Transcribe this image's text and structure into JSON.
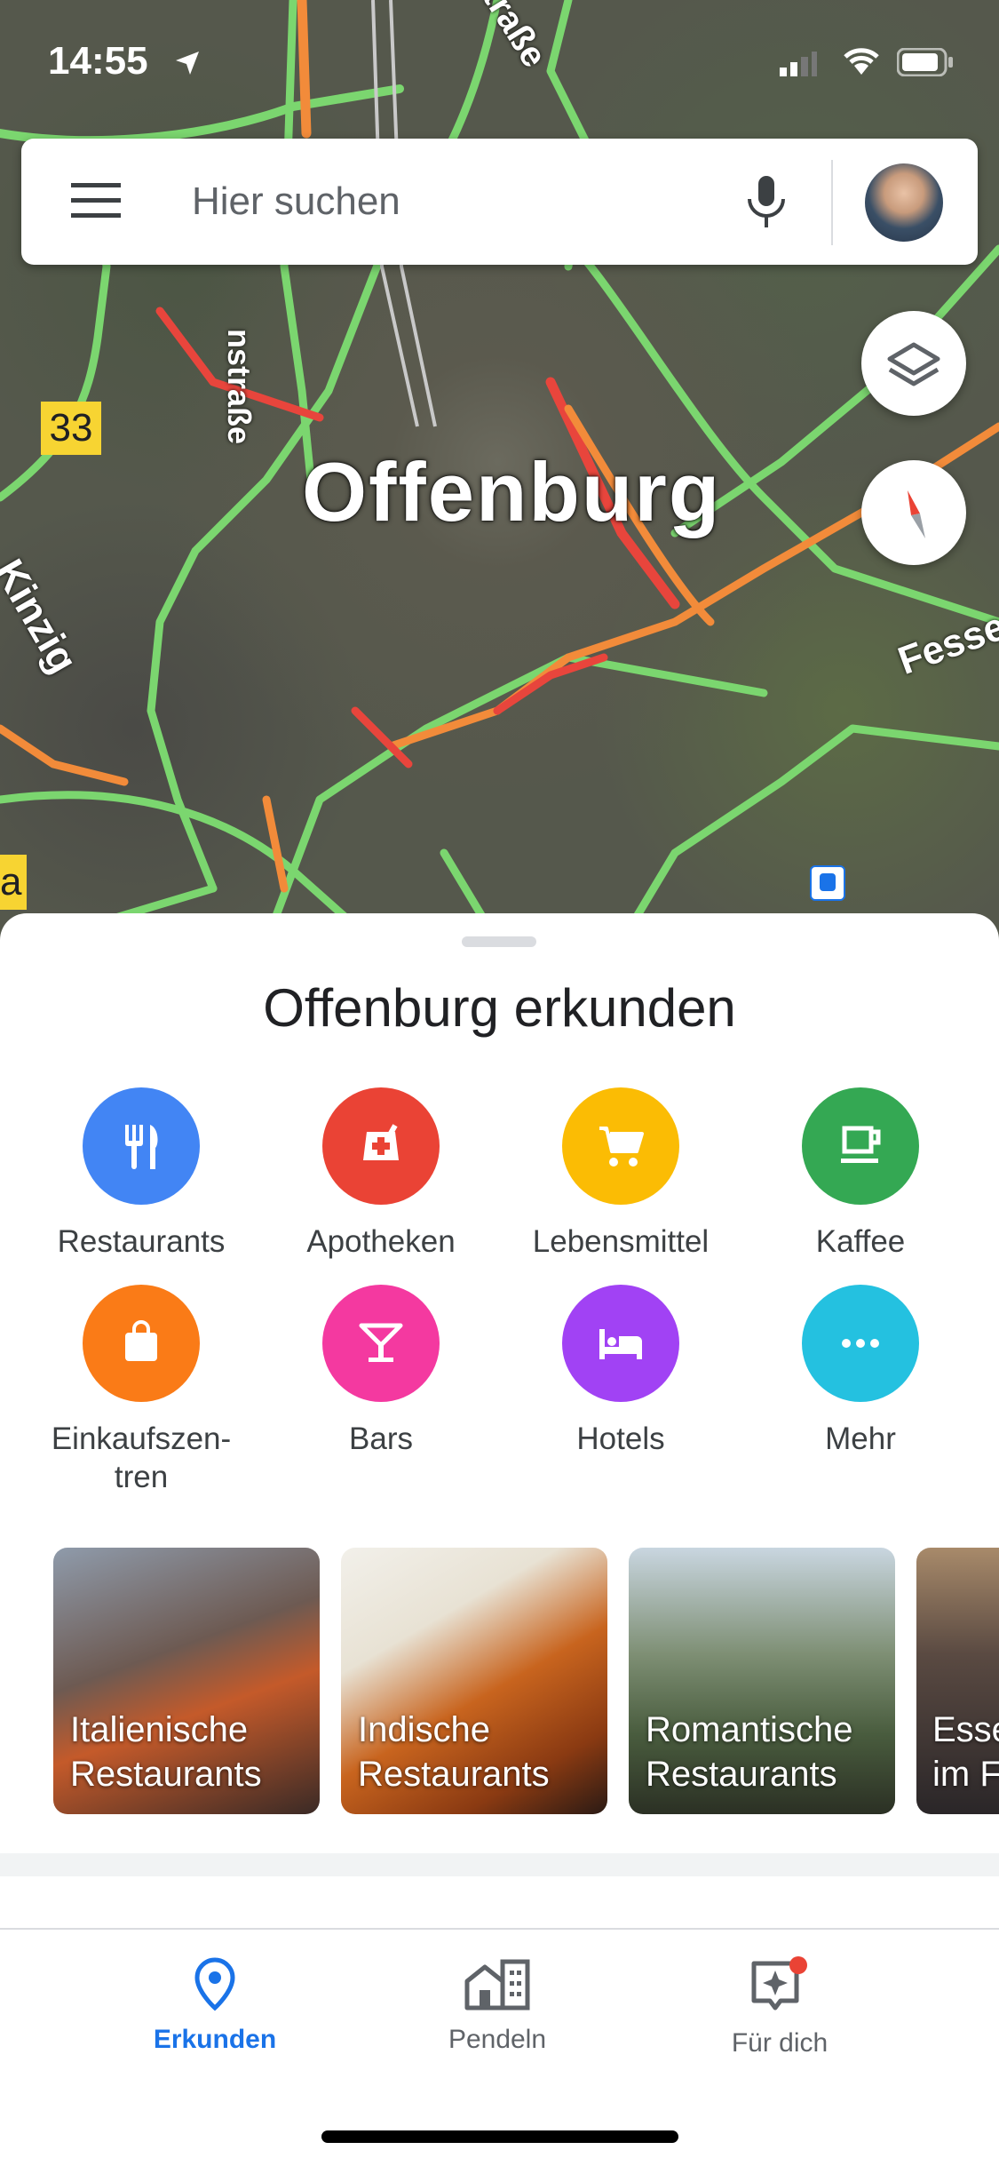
{
  "status_bar": {
    "time": "14:55"
  },
  "search": {
    "placeholder": "Hier suchen"
  },
  "map": {
    "city_label": "Offenburg",
    "labels": {
      "strasse_top": "traße",
      "strasse_vertical": "nstraße",
      "kinzig": "Kinzig",
      "fesse": "Fesse",
      "route_33": "33",
      "route_a": "a"
    }
  },
  "sheet": {
    "title": "Offenburg erkunden",
    "categories": [
      {
        "label": "Restaurants",
        "icon": "fork-knife-icon",
        "color": "#4285f4"
      },
      {
        "label": "Apotheken",
        "icon": "pharmacy-icon",
        "color": "#ea4335"
      },
      {
        "label": "Lebensmittel",
        "icon": "cart-icon",
        "color": "#fbbc04"
      },
      {
        "label": "Kaffee",
        "icon": "coffee-icon",
        "color": "#34a853"
      },
      {
        "label": "Einkaufszen-\ntren",
        "icon": "shopping-bag-icon",
        "color": "#fa7b17"
      },
      {
        "label": "Bars",
        "icon": "cocktail-icon",
        "color": "#f439a0"
      },
      {
        "label": "Hotels",
        "icon": "bed-icon",
        "color": "#a142f4"
      },
      {
        "label": "Mehr",
        "icon": "more-icon",
        "color": "#24c1e0"
      }
    ],
    "cards": [
      {
        "label": "Italienische\nRestaurants"
      },
      {
        "label": "Indische\nRestaurants"
      },
      {
        "label": "Romantische\nRestaurants"
      },
      {
        "label": "Esse\nim F"
      }
    ]
  },
  "nav": {
    "items": [
      {
        "label": "Erkunden",
        "icon": "location-pin-icon",
        "active": true
      },
      {
        "label": "Pendeln",
        "icon": "commute-icon",
        "active": false
      },
      {
        "label": "Für dich",
        "icon": "for-you-icon",
        "active": false
      }
    ],
    "active_color": "#1a73e8",
    "inactive_color": "#5f6368"
  }
}
